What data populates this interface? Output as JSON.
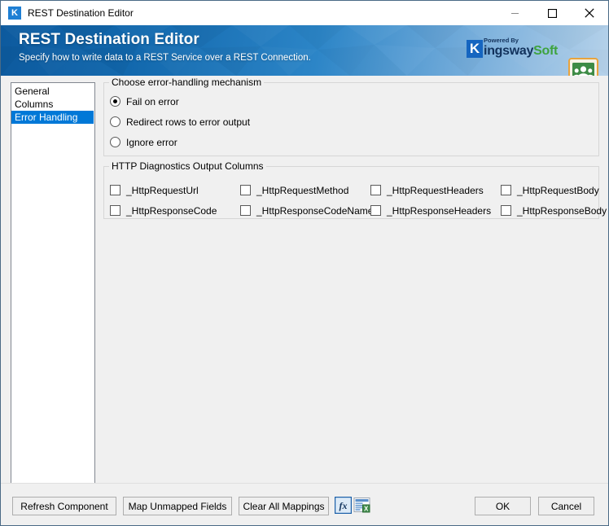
{
  "window": {
    "title": "REST Destination Editor",
    "app_icon": "K",
    "controls": {
      "minimize": "minimize-icon",
      "maximize": "maximize-icon",
      "close": "close-icon"
    }
  },
  "banner": {
    "title": "REST Destination Editor",
    "subtitle": "Specify how to write data to a REST Service over a REST Connection.",
    "logo": {
      "mark": "K",
      "powered_by": "Powered By",
      "kingsway": "ingsway",
      "soft": "Soft"
    },
    "product_icon": "google-classroom-icon",
    "colors": {
      "banner_start": "#0d5a9e",
      "banner_end": "#b6d2ea",
      "logo_blue": "#12325c",
      "logo_green": "#3ea33e"
    }
  },
  "sidebar": {
    "items": [
      {
        "label": "General",
        "selected": false
      },
      {
        "label": "Columns",
        "selected": false
      },
      {
        "label": "Error Handling",
        "selected": true
      }
    ],
    "selection_color": "#0078d7"
  },
  "error_handling": {
    "legend": "Choose error-handling mechanism",
    "options": [
      {
        "label": "Fail on error",
        "checked": true
      },
      {
        "label": "Redirect rows to error output",
        "checked": false
      },
      {
        "label": "Ignore error",
        "checked": false
      }
    ]
  },
  "http_diagnostics": {
    "legend": "HTTP Diagnostics Output Columns",
    "columns": [
      {
        "label": "_HttpRequestUrl",
        "checked": false
      },
      {
        "label": "_HttpRequestMethod",
        "checked": false
      },
      {
        "label": "_HttpRequestHeaders",
        "checked": false
      },
      {
        "label": "_HttpRequestBody",
        "checked": false
      },
      {
        "label": "_HttpResponseCode",
        "checked": false
      },
      {
        "label": "_HttpResponseCodeName",
        "checked": false
      },
      {
        "label": "_HttpResponseHeaders",
        "checked": false
      },
      {
        "label": "_HttpResponseBody",
        "checked": false
      }
    ]
  },
  "footer": {
    "refresh_label": "Refresh Component",
    "map_unmapped_label": "Map Unmapped Fields",
    "clear_mappings_label": "Clear All Mappings",
    "fx_icon": "expression-editor-icon",
    "export_icon": "export-to-excel-icon",
    "ok_label": "OK",
    "cancel_label": "Cancel"
  }
}
